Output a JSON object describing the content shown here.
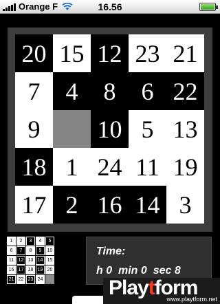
{
  "status": {
    "carrier": "Orange F",
    "time": "16.56"
  },
  "board": {
    "rows": [
      [
        {
          "n": "20",
          "c": "dark"
        },
        {
          "n": "15",
          "c": "light"
        },
        {
          "n": "12",
          "c": "dark"
        },
        {
          "n": "23",
          "c": "light"
        },
        {
          "n": "21",
          "c": "light"
        }
      ],
      [
        {
          "n": "7",
          "c": "light"
        },
        {
          "n": "4",
          "c": "dark"
        },
        {
          "n": "8",
          "c": "dark"
        },
        {
          "n": "6",
          "c": "dark"
        },
        {
          "n": "22",
          "c": "dark"
        }
      ],
      [
        {
          "n": "9",
          "c": "light"
        },
        {
          "n": "",
          "c": "empty"
        },
        {
          "n": "10",
          "c": "dark"
        },
        {
          "n": "5",
          "c": "light"
        },
        {
          "n": "13",
          "c": "light"
        }
      ],
      [
        {
          "n": "18",
          "c": "dark"
        },
        {
          "n": "1",
          "c": "light"
        },
        {
          "n": "24",
          "c": "light"
        },
        {
          "n": "11",
          "c": "light"
        },
        {
          "n": "19",
          "c": "light"
        }
      ],
      [
        {
          "n": "17",
          "c": "light"
        },
        {
          "n": "2",
          "c": "dark"
        },
        {
          "n": "16",
          "c": "dark"
        },
        {
          "n": "14",
          "c": "dark"
        },
        {
          "n": "3",
          "c": "light"
        }
      ]
    ]
  },
  "mini": {
    "rows": [
      [
        {
          "n": "1",
          "c": "light"
        },
        {
          "n": "2",
          "c": "light"
        },
        {
          "n": "3",
          "c": "dark"
        },
        {
          "n": "4",
          "c": "light"
        },
        {
          "n": "5",
          "c": "dark"
        }
      ],
      [
        {
          "n": "6",
          "c": "light"
        },
        {
          "n": "7",
          "c": "dark"
        },
        {
          "n": "8",
          "c": "light"
        },
        {
          "n": "9",
          "c": "dark"
        },
        {
          "n": "10",
          "c": "light"
        }
      ],
      [
        {
          "n": "11",
          "c": "light"
        },
        {
          "n": "12",
          "c": "dark"
        },
        {
          "n": "13",
          "c": "light"
        },
        {
          "n": "14",
          "c": "dark"
        },
        {
          "n": "15",
          "c": "light"
        }
      ],
      [
        {
          "n": "16",
          "c": "light"
        },
        {
          "n": "17",
          "c": "dark"
        },
        {
          "n": "18",
          "c": "light"
        },
        {
          "n": "19",
          "c": "dark"
        },
        {
          "n": "20",
          "c": "light"
        }
      ],
      [
        {
          "n": "21",
          "c": "dark"
        },
        {
          "n": "22",
          "c": "light"
        },
        {
          "n": "23",
          "c": "dark"
        },
        {
          "n": "24",
          "c": "light"
        },
        {
          "n": "",
          "c": "empty"
        }
      ]
    ]
  },
  "timer": {
    "label": "Time:",
    "value": "h 0  min 0  sec 8"
  },
  "watermark": {
    "logo_a": "Play",
    "logo_b": "t",
    "logo_c": "form",
    "url": "www.playtform.net"
  }
}
